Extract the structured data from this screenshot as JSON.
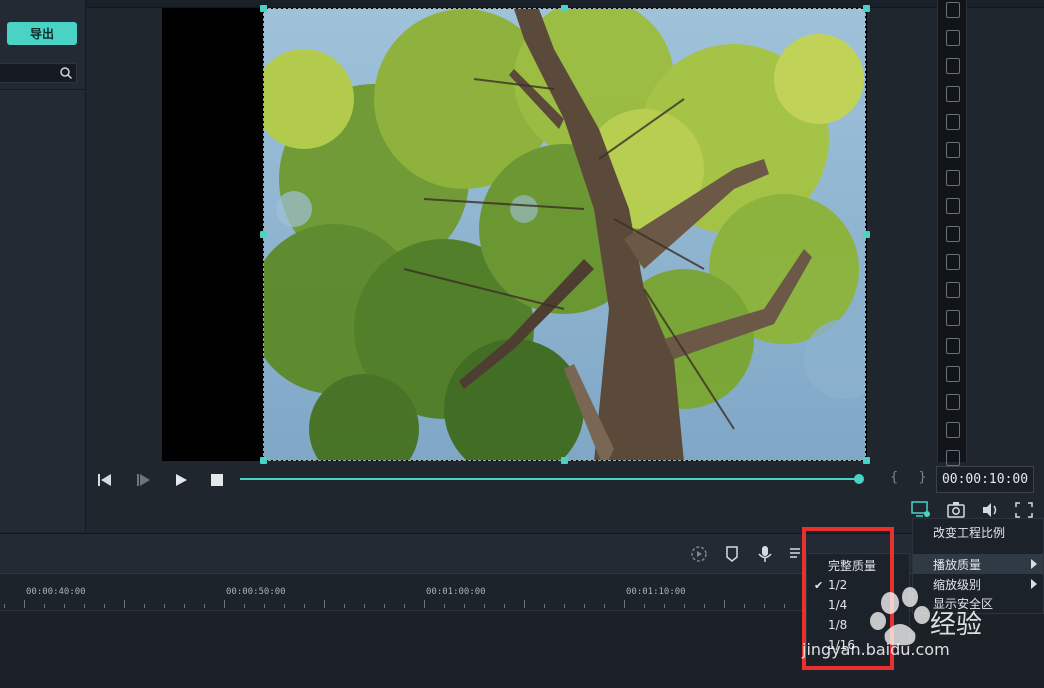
{
  "left_panel": {
    "export_label": "导出",
    "search_placeholder": ""
  },
  "player": {
    "timecode": "00:00:10:00",
    "progress_fraction": 1.0,
    "brace_marks": "{ }"
  },
  "context_menu": {
    "items": [
      {
        "label": "改变工程比例",
        "has_submenu": false
      },
      {
        "label": "播放质量",
        "has_submenu": true,
        "active": true
      },
      {
        "label": "缩放级别",
        "has_submenu": true
      },
      {
        "label": "显示安全区",
        "has_submenu": false
      }
    ]
  },
  "quality_submenu": {
    "items": [
      {
        "label": "完整质量",
        "checked": false
      },
      {
        "label": "1/2",
        "checked": true
      },
      {
        "label": "1/4",
        "checked": false
      },
      {
        "label": "1/8",
        "checked": false
      },
      {
        "label": "1/16",
        "checked": false
      }
    ]
  },
  "timeline": {
    "ticks": [
      "00:00:40:00",
      "00:00:50:00",
      "00:01:00:00",
      "00:01:10:00"
    ]
  },
  "watermark": {
    "brand": "Bai 经验",
    "url": "jingyan.baidu.com"
  },
  "colors": {
    "accent": "#4ad3c4",
    "highlight_box": "#e8302e",
    "background": "#1f262e"
  },
  "icons": [
    "search-icon",
    "prev-frame-icon",
    "next-frame-icon",
    "play-icon",
    "stop-icon",
    "display-settings-icon",
    "snapshot-icon",
    "volume-icon",
    "fullscreen-icon",
    "render-icon",
    "marker-icon",
    "microphone-icon",
    "audio-mixer-icon"
  ]
}
